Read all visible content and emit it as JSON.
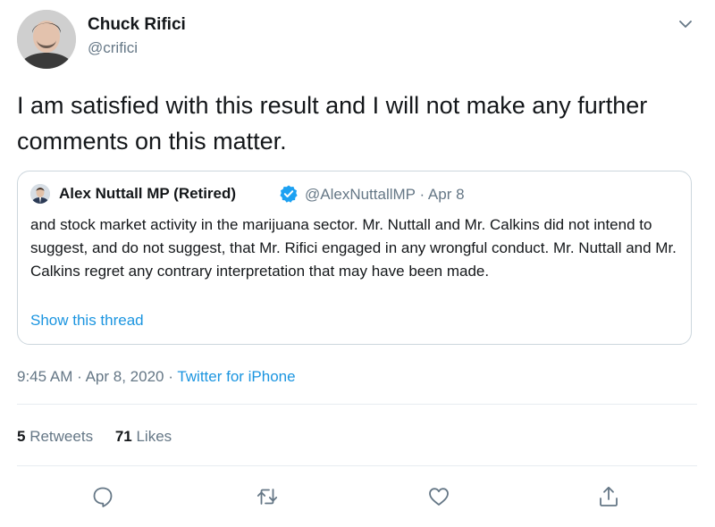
{
  "author": {
    "name": "Chuck Rifici",
    "handle": "@crifici"
  },
  "tweet": {
    "text": "I am satisfied with this result and I will not make any further comments on this matter."
  },
  "quote": {
    "author_name": "Alex Nuttall MP (Retired)",
    "handle": "@AlexNuttallMP",
    "separator": "·",
    "date": "Apr 8",
    "text": "and stock market activity in the marijuana sector. Mr. Nuttall and Mr. Calkins did not intend to suggest, and do not suggest, that Mr. Rifici engaged in any wrongful conduct. Mr. Nuttall and Mr. Calkins regret any contrary interpretation that may have been made.",
    "show_thread": "Show this thread"
  },
  "meta": {
    "time": "9:45 AM",
    "sep1": "·",
    "date": "Apr 8, 2020",
    "sep2": "·",
    "source": "Twitter for iPhone"
  },
  "stats": {
    "retweets_count": "5",
    "retweets_label": "Retweets",
    "likes_count": "71",
    "likes_label": "Likes"
  },
  "icons": {
    "caret": "chevron-down-icon",
    "verified": "verified-badge-icon",
    "reply": "reply-icon",
    "retweet": "retweet-icon",
    "like": "heart-icon",
    "share": "share-icon"
  },
  "colors": {
    "text": "#14171a",
    "secondary": "#657786",
    "link": "#1b95e0",
    "border": "#ccd6dd",
    "divider": "#e6ecf0"
  }
}
